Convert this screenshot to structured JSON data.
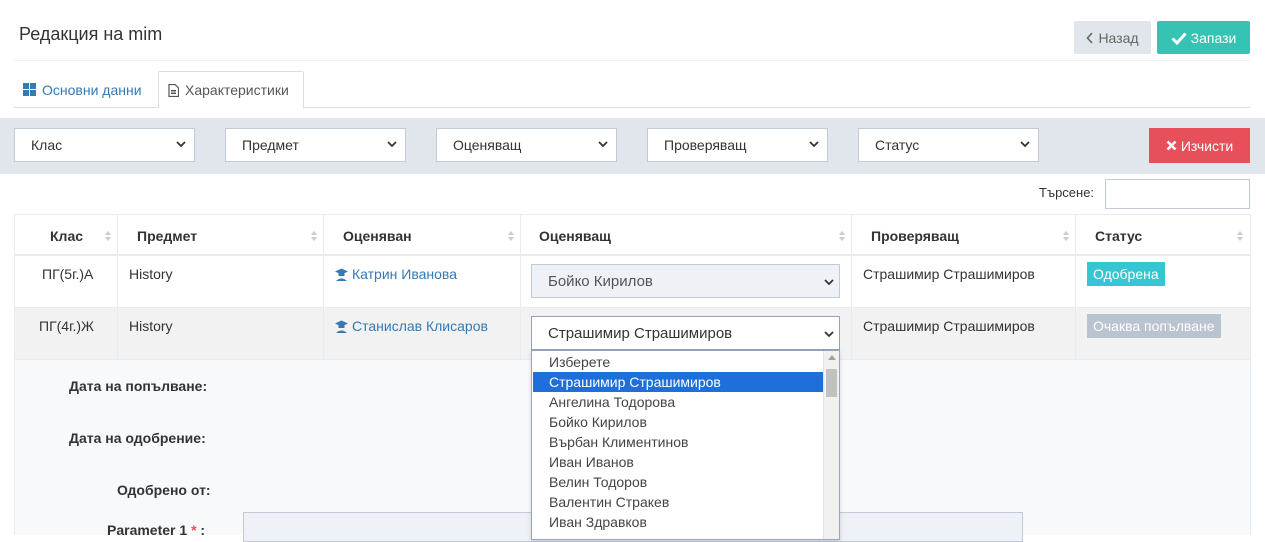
{
  "header": {
    "title": "Редакция на mim",
    "back_label": "Назад",
    "save_label": "Запази"
  },
  "tabs": [
    {
      "label": "Основни данни"
    },
    {
      "label": "Характеристики"
    }
  ],
  "filters": {
    "class": "Клас",
    "subject": "Предмет",
    "assessor": "Оценяващ",
    "checker": "Проверяващ",
    "status": "Статус",
    "clear_label": "Изчисти"
  },
  "search": {
    "label": "Търсене:",
    "value": ""
  },
  "table": {
    "headers": [
      "Клас",
      "Предмет",
      "Оценяван",
      "Оценяващ",
      "Проверяващ",
      "Статус"
    ],
    "rows": [
      {
        "class": "ПГ(5г.)А",
        "subject": "History",
        "assessed": "Катрин Иванова",
        "assessor": "Бойко Кирилов",
        "checker": "Страшимир Страшимиров",
        "status": "Одобрена"
      },
      {
        "class": "ПГ(4г.)Ж",
        "subject": "History",
        "assessed": "Станислав Клисаров",
        "assessor": "Страшимир Страшимиров",
        "checker": "Страшимир Страшимиров",
        "status": "Очаква попълване"
      }
    ]
  },
  "detail": {
    "fill_date_label": "Дата на попълване:",
    "approve_date_label": "Дата на одобрение:",
    "approved_by_label": "Одобрено от:",
    "param1_label": "Parameter 1",
    "param1_required": "*",
    "param1_colon": ":"
  },
  "dropdown": {
    "options": [
      "Изберете",
      "Страшимир Страшимиров",
      "Ангелина Тодорова",
      "Бойко Кирилов",
      "Върбан Климентинов",
      "Иван Иванов",
      "Велин Тодоров",
      "Валентин Стракев",
      "Иван Здравков"
    ],
    "selected": "Страшимир Страшимиров"
  },
  "colors": {
    "save": "#36c3b4",
    "clear": "#e7505a",
    "approved_badge": "#36c6d3",
    "pending_badge": "#bac3d0",
    "link": "#337ab7",
    "selected_option": "#1e6fd9"
  }
}
